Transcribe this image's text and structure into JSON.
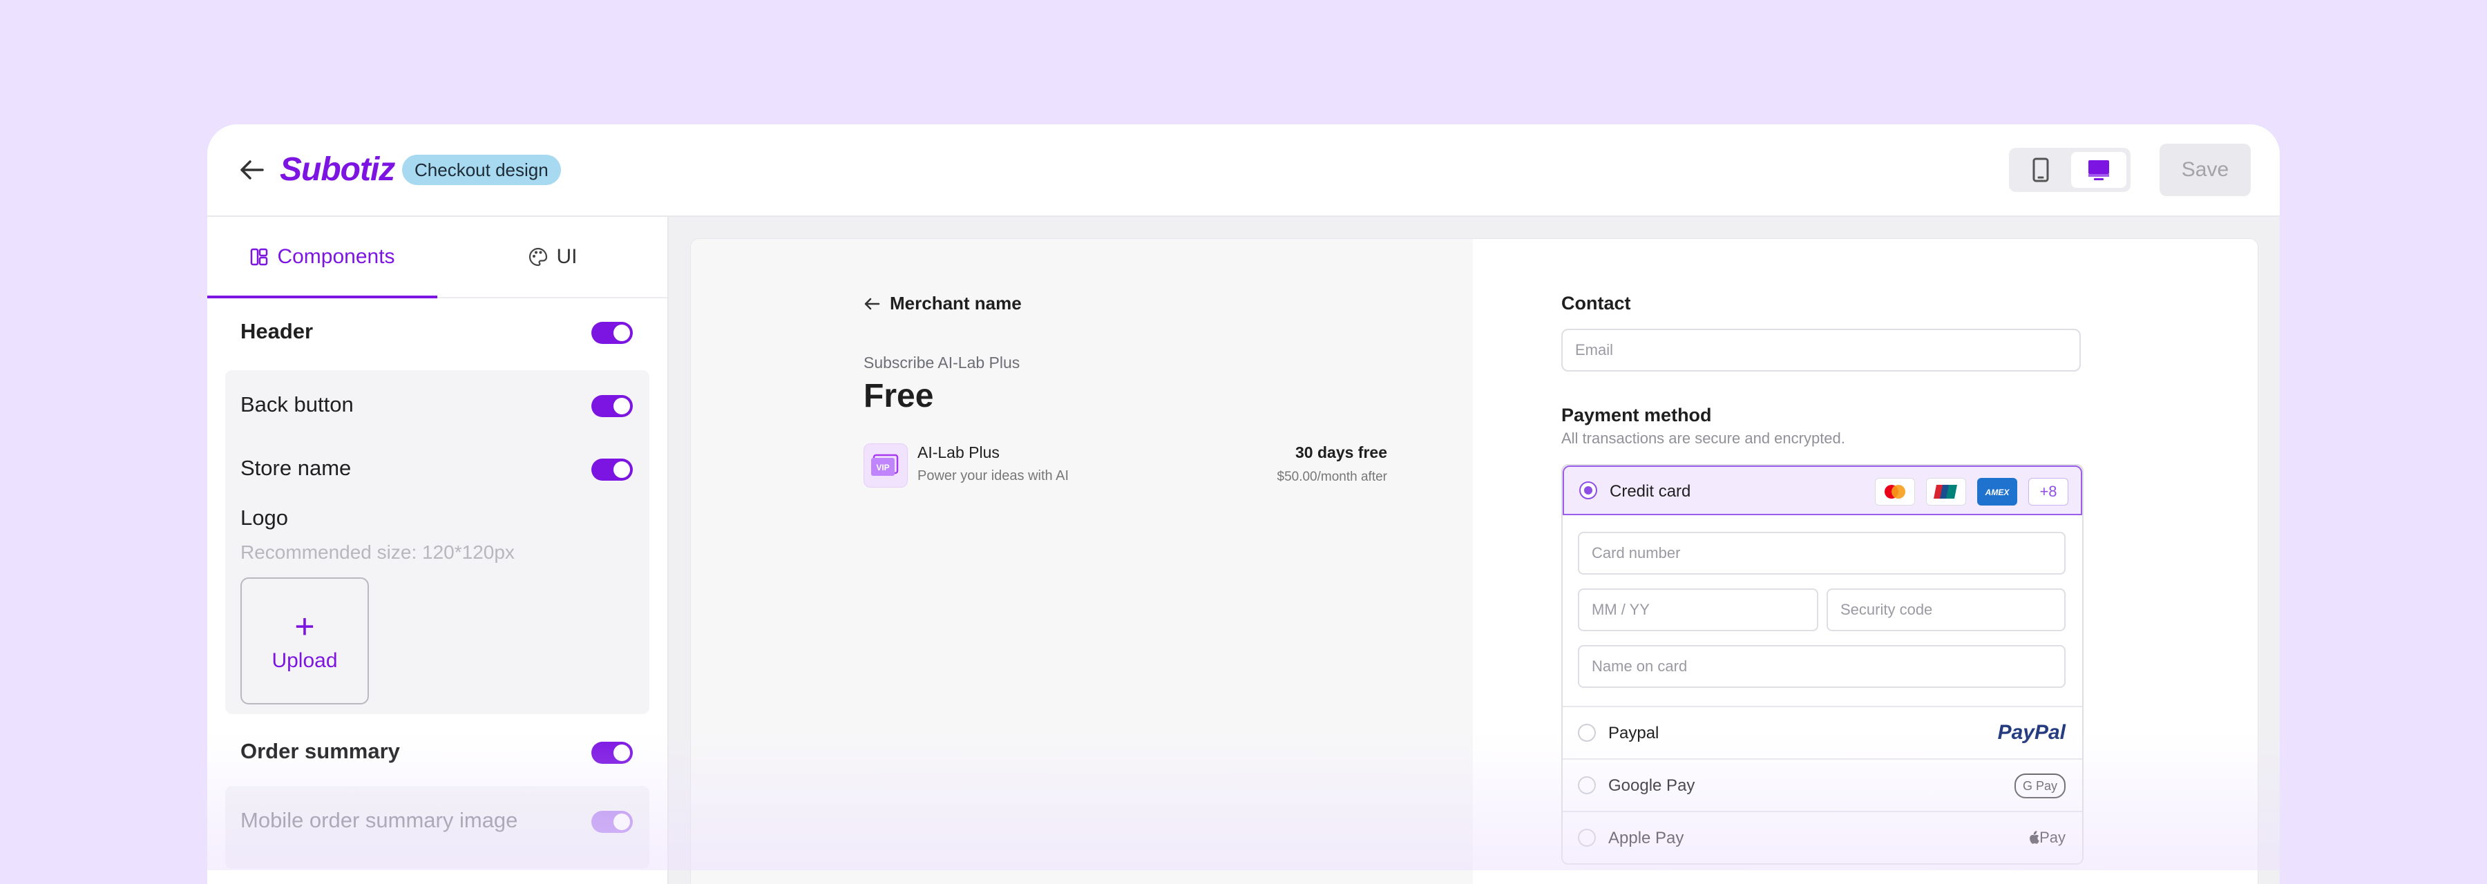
{
  "topbar": {
    "logo": "Subotiz",
    "badge": "Checkout design",
    "save_label": "Save"
  },
  "sidebar": {
    "tabs": [
      {
        "label": "Components",
        "active": true
      },
      {
        "label": "UI",
        "active": false
      }
    ],
    "header": {
      "label": "Header",
      "enabled": true
    },
    "back_button": {
      "label": "Back button",
      "enabled": true
    },
    "store_name": {
      "label": "Store name",
      "enabled": true
    },
    "logo": {
      "label": "Logo",
      "hint": "Recommended size: 120*120px",
      "upload_label": "Upload"
    },
    "order_summary": {
      "label": "Order summary",
      "enabled": true
    },
    "mobile_image": {
      "label": "Mobile order summary image",
      "enabled": true
    }
  },
  "preview": {
    "merchant_name": "Merchant name",
    "subscribe_line": "Subscribe AI-Lab Plus",
    "price": "Free",
    "product": {
      "name": "AI-Lab Plus",
      "description": "Power your ideas with AI",
      "trial": "30 days free",
      "after": "$50.00/month after",
      "icon_text": "VIP"
    },
    "contact": {
      "title": "Contact",
      "email_placeholder": "Email"
    },
    "payment": {
      "title": "Payment method",
      "note": "All transactions are secure and encrypted.",
      "credit_card": {
        "label": "Credit card",
        "more": "+8",
        "card_number": "Card number",
        "expiry": "MM / YY",
        "security": "Security code",
        "name": "Name on card"
      },
      "paypal": {
        "label": "Paypal",
        "logo": "PayPal"
      },
      "google_pay": {
        "label": "Google Pay",
        "logo": "G Pay"
      },
      "apple_pay": {
        "label": "Apple Pay",
        "logo": "Pay"
      }
    }
  },
  "colors": {
    "accent": "#7c15e2",
    "background": "#ece1fe"
  }
}
